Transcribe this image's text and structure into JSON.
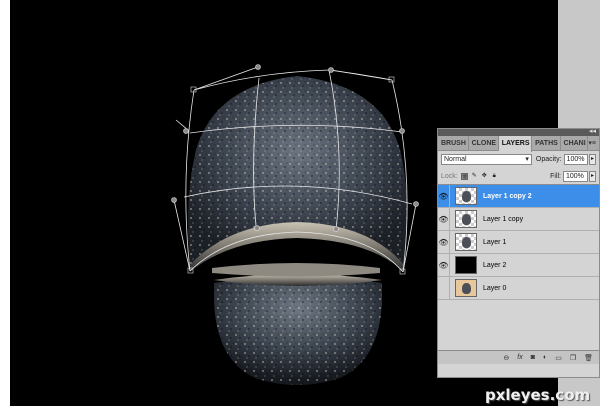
{
  "panel": {
    "tabs": [
      {
        "label": "BRUSH",
        "active": false
      },
      {
        "label": "CLONE",
        "active": false
      },
      {
        "label": "LAYERS",
        "active": true
      },
      {
        "label": "PATHS",
        "active": false
      },
      {
        "label": "CHANI",
        "active": false
      }
    ],
    "blend_mode": "Normal",
    "opacity_label": "Opacity:",
    "opacity_value": "100%",
    "lock_label": "Lock:",
    "fill_label": "Fill:",
    "fill_value": "100%",
    "layers": [
      {
        "name": "Layer 1 copy 2",
        "selected": true,
        "visible": true,
        "thumb": "checker"
      },
      {
        "name": "Layer 1 copy",
        "selected": false,
        "visible": true,
        "thumb": "checker"
      },
      {
        "name": "Layer 1",
        "selected": false,
        "visible": true,
        "thumb": "checker"
      },
      {
        "name": "Layer 2",
        "selected": false,
        "visible": true,
        "thumb": "black"
      },
      {
        "name": "Layer 0",
        "selected": false,
        "visible": false,
        "thumb": "photo"
      }
    ],
    "bottom_icons": [
      "link-icon",
      "fx-icon",
      "mask-icon",
      "adjustment-icon",
      "group-icon",
      "new-layer-icon",
      "trash-icon"
    ]
  },
  "watermark": "pxleyes.com",
  "colors": {
    "canvas_bg": "#000000",
    "selection_blue": "#3d8ee8",
    "panel_bg": "#d4d4d4"
  }
}
